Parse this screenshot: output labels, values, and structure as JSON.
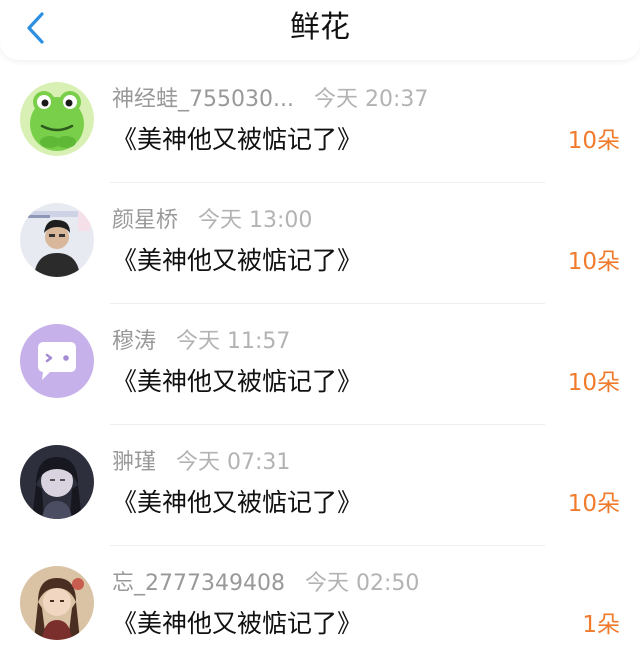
{
  "header": {
    "title": "鲜花",
    "back_icon": "chevron-left-icon",
    "accent_color": "#2c8fe0"
  },
  "records": [
    {
      "user": "神经蛙_755030...",
      "time": "今天 20:37",
      "book": "《美神他又被惦记了》",
      "amount": "10朵",
      "avatar": "green-frog-avatar"
    },
    {
      "user": "颜星桥",
      "time": "今天 13:00",
      "book": "《美神他又被惦记了》",
      "amount": "10朵",
      "avatar": "person-photo-avatar"
    },
    {
      "user": "穆涛",
      "time": "今天 11:57",
      "book": "《美神他又被惦记了》",
      "amount": "10朵",
      "avatar": "chat-bubble-avatar"
    },
    {
      "user": "翀瑾",
      "time": "今天 07:31",
      "book": "《美神他又被惦记了》",
      "amount": "10朵",
      "avatar": "dark-anime-avatar"
    },
    {
      "user": "忘_2777349408",
      "time": "今天 02:50",
      "book": "《美神他又被惦记了》",
      "amount": "1朵",
      "avatar": "anime-character-avatar"
    }
  ],
  "colors": {
    "amount": "#f07b2c",
    "meta_text": "#999999",
    "title_text": "#111111"
  }
}
